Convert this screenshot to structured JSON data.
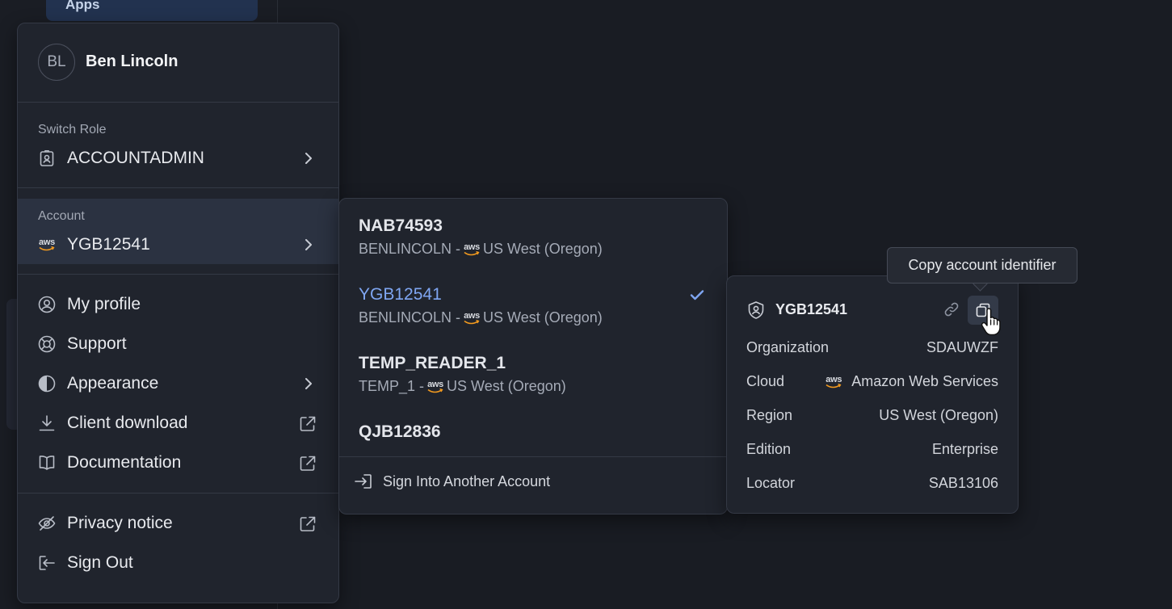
{
  "background": {
    "apps_label": "Apps"
  },
  "user": {
    "initials": "BL",
    "name": "Ben Lincoln"
  },
  "role": {
    "section_label": "Switch Role",
    "value": "ACCOUNTADMIN"
  },
  "account": {
    "section_label": "Account",
    "value": "YGB12541",
    "provider_icon": "aws-logo"
  },
  "menu_items": [
    {
      "label": "My profile",
      "icon": "user-circle-icon"
    },
    {
      "label": "Support",
      "icon": "lifebuoy-icon"
    },
    {
      "label": "Appearance",
      "icon": "contrast-icon"
    },
    {
      "label": "Client download",
      "icon": "download-icon"
    },
    {
      "label": "Documentation",
      "icon": "book-icon"
    },
    {
      "label": "Privacy notice",
      "icon": "eye-slash-icon"
    },
    {
      "label": "Sign Out",
      "icon": "sign-out-icon"
    }
  ],
  "accounts": [
    {
      "name": "NAB74593",
      "org": "BENLINCOLN -",
      "region": "US West (Oregon)",
      "selected": false
    },
    {
      "name": "YGB12541",
      "org": "BENLINCOLN -",
      "region": "US West (Oregon)",
      "selected": true
    },
    {
      "name": "TEMP_READER_1",
      "org": "TEMP_1 -",
      "region": "US West (Oregon)",
      "selected": false
    },
    {
      "name": "QJB12836"
    }
  ],
  "sign_into_another": "Sign Into Another Account",
  "details": {
    "title": "YGB12541",
    "rows": [
      {
        "label": "Organization",
        "value": "SDAUWZF"
      },
      {
        "label": "Cloud",
        "value": "Amazon Web Services"
      },
      {
        "label": "Region",
        "value": "US West (Oregon)"
      },
      {
        "label": "Edition",
        "value": "Enterprise"
      },
      {
        "label": "Locator",
        "value": "SAB13106"
      }
    ]
  },
  "tooltip": "Copy account identifier",
  "aws_text": "aws",
  "colors": {
    "accent": "#7fa6f2",
    "panel": "#20242d",
    "selected_row": "#2b3241"
  }
}
